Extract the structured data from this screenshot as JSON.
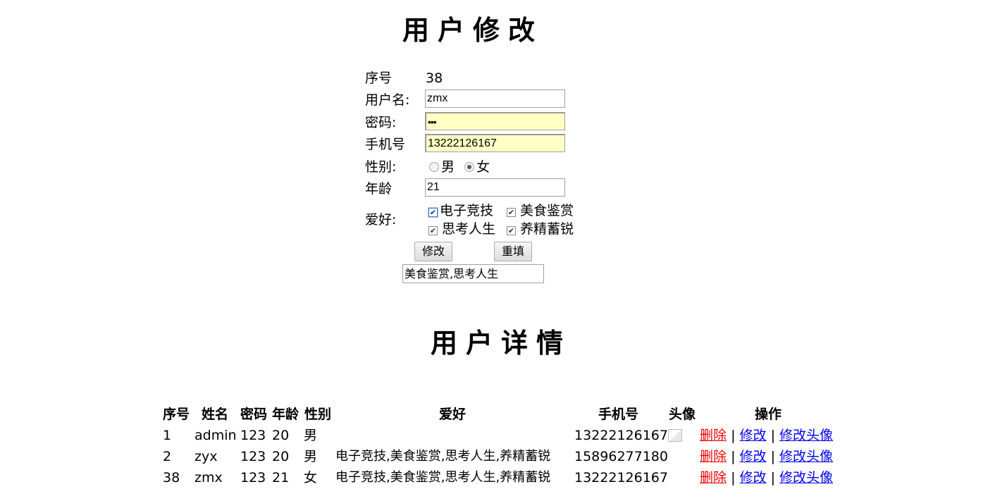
{
  "edit_form": {
    "title": "用户修改",
    "id_label": "序号",
    "id_value": "38",
    "username_label": "用户名:",
    "username_value": "zmx",
    "password_label": "密码:",
    "password_value": "•••",
    "phone_label": "手机号",
    "phone_value": "13222126167",
    "gender_label": "性别:",
    "gender_male": "男",
    "gender_female": "女",
    "gender_selected": "女",
    "age_label": "年龄",
    "age_value": "21",
    "hobby_label": "爱好:",
    "hobbies": [
      {
        "label": "电子竞技",
        "checked": true
      },
      {
        "label": "美食鉴赏",
        "checked": true
      },
      {
        "label": "思考人生",
        "checked": true
      },
      {
        "label": "养精蓄锐",
        "checked": true
      }
    ],
    "submit_label": "修改",
    "reset_label": "重填",
    "result_text": "美食鉴赏,思考人生"
  },
  "detail": {
    "title": "用户详情",
    "headers": {
      "id": "序号",
      "name": "姓名",
      "password": "密码",
      "age": "年龄",
      "gender": "性别",
      "hobby": "爱好",
      "phone": "手机号",
      "avatar": "头像",
      "action": "操作"
    },
    "rows": [
      {
        "id": "1",
        "name": "admin",
        "password": "123",
        "age": "20",
        "gender": "男",
        "hobby": "",
        "phone": "13222126167"
      },
      {
        "id": "2",
        "name": "zyx",
        "password": "123",
        "age": "20",
        "gender": "男",
        "hobby": "电子竞技,美食鉴赏,思考人生,养精蓄锐",
        "phone": "15896277180"
      },
      {
        "id": "38",
        "name": "zmx",
        "password": "123",
        "age": "21",
        "gender": "女",
        "hobby": "电子竞技,美食鉴赏,思考人生,养精蓄锐",
        "phone": "13222126167"
      }
    ],
    "actions": {
      "delete": "删除",
      "edit": "修改",
      "edit_avatar": "修改头像",
      "separator": "|"
    }
  }
}
